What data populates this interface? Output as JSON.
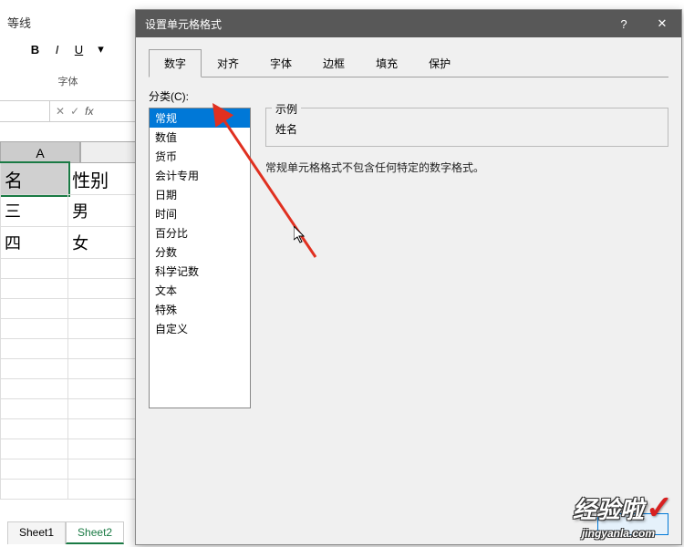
{
  "ribbon": {
    "tab_label": "等线",
    "section_label": "字体",
    "bold": "B",
    "italic": "I",
    "underline": "U"
  },
  "formula": {
    "fx": "fx"
  },
  "grid": {
    "col_a": "A",
    "row1_a": "名",
    "row1_b": "性别",
    "row2_a": "三",
    "row2_b": "男",
    "row3_a": "四",
    "row3_b": "女"
  },
  "sheets": {
    "sheet1": "Sheet1",
    "sheet2": "Sheet2"
  },
  "dialog": {
    "title": "设置单元格格式",
    "help": "?",
    "close": "✕",
    "tabs": {
      "number": "数字",
      "align": "对齐",
      "font": "字体",
      "border": "边框",
      "fill": "填充",
      "protect": "保护"
    },
    "category_label": "分类(C):",
    "categories": {
      "general": "常规",
      "number": "数值",
      "currency": "货币",
      "accounting": "会计专用",
      "date": "日期",
      "time": "时间",
      "percent": "百分比",
      "fraction": "分数",
      "scientific": "科学记数",
      "text": "文本",
      "special": "特殊",
      "custom": "自定义"
    },
    "example_label": "示例",
    "example_value": "姓名",
    "description": "常规单元格格式不包含任何特定的数字格式。"
  },
  "watermark": {
    "text": "经验啦",
    "sub": "jingyanla.com"
  }
}
